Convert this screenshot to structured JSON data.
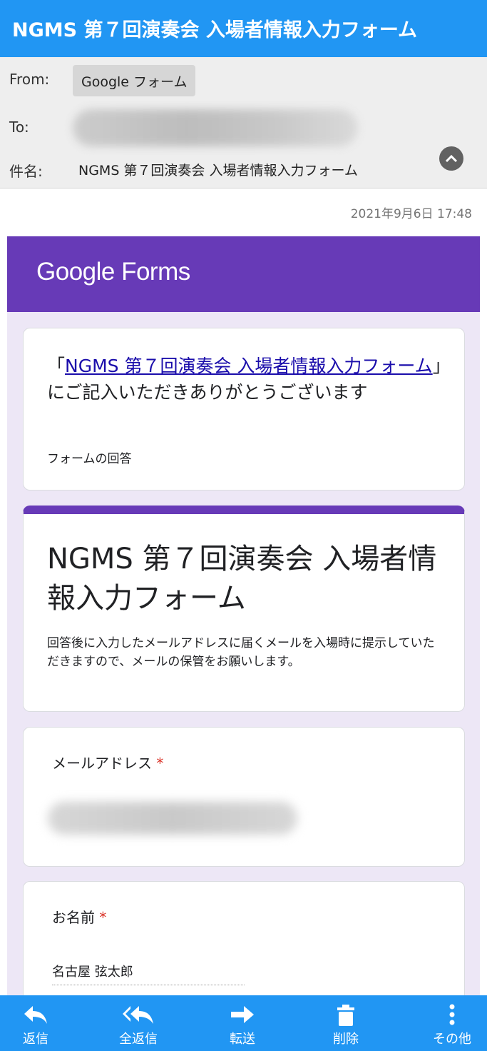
{
  "app": {
    "title": "NGMS 第７回演奏会 入場者情報入力フォーム"
  },
  "header": {
    "from_label": "From:",
    "from_value": "Google フォーム",
    "to_label": "To:",
    "subject_label": "件名:",
    "subject_value": "NGMS 第７回演奏会 入場者情報入力フォーム",
    "collapse_icon": "chevron-up-icon"
  },
  "date": "2021年9月6日 17:48",
  "forms": {
    "logo": "Google Forms",
    "brand_color": "#673ab7",
    "thanks": {
      "open_quote": "「",
      "link_text": "NGMS 第７回演奏会 入場者情報入力フォーム",
      "rest": "」にご記入いただきありがとうございます",
      "sub": "フォームの回答"
    },
    "form_title": "NGMS 第７回演奏会 入場者情報入力フォーム",
    "form_desc": "回答後に入力したメールアドレスに届くメールを入場時に提示していただきますので、メールの保管をお願いします。",
    "questions": [
      {
        "label": "メールアドレス",
        "required_mark": "*"
      },
      {
        "label": "お名前",
        "required_mark": "*",
        "answer": "名古屋 弦太郎"
      }
    ]
  },
  "bottom_bar": {
    "accent": "#2196f3",
    "buttons": [
      {
        "label": "返信",
        "icon": "reply-icon"
      },
      {
        "label": "全返信",
        "icon": "reply-all-icon"
      },
      {
        "label": "転送",
        "icon": "forward-icon"
      },
      {
        "label": "削除",
        "icon": "trash-icon"
      },
      {
        "label": "その他",
        "icon": "more-vertical-icon"
      }
    ]
  }
}
